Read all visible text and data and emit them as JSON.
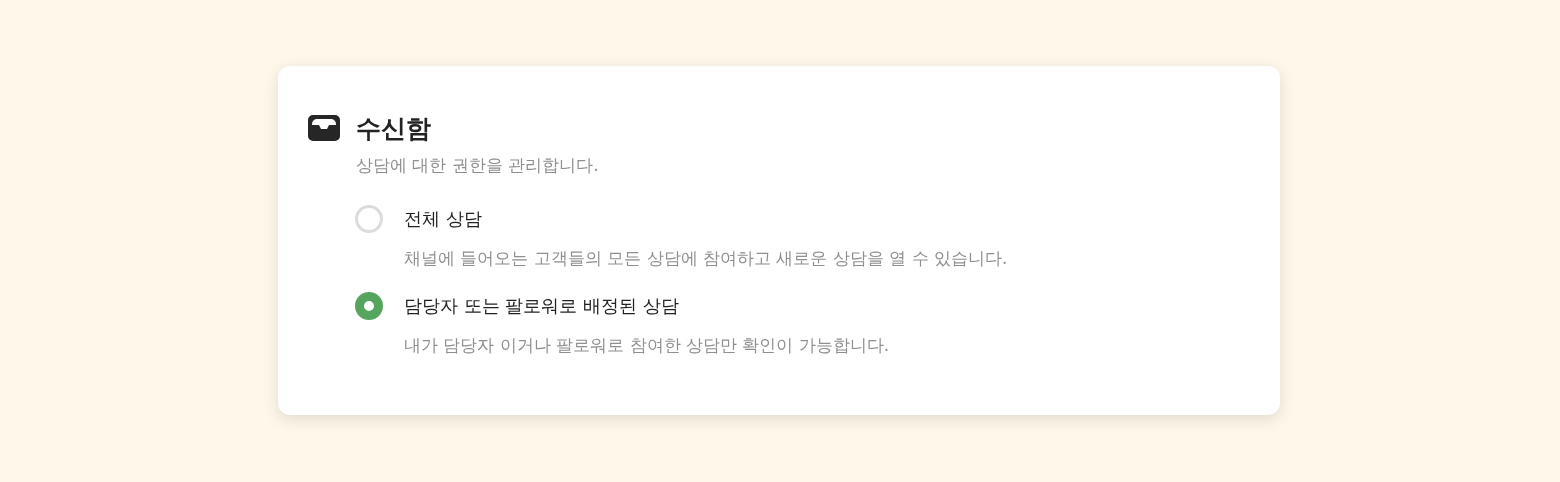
{
  "section": {
    "title": "수신함",
    "description": "상담에 대한 권한을 관리합니다."
  },
  "options": [
    {
      "label": "전체 상담",
      "description": "채널에 들어오는 고객들의 모든 상담에 참여하고 새로운 상담을 열 수 있습니다.",
      "selected": false
    },
    {
      "label": "담당자 또는 팔로워로 배정된 상담",
      "description": "내가 담당자 이거나 팔로워로 참여한 상담만 확인이 가능합니다.",
      "selected": true
    }
  ]
}
